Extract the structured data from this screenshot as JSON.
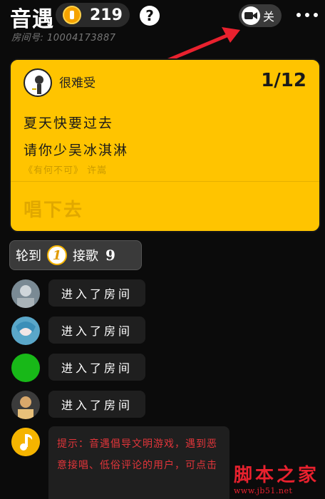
{
  "header": {
    "app_title": "音遇",
    "coin_count": "219",
    "help_label": "?",
    "room_number": "房间号: 10004173887",
    "camera_toggle_label": "关"
  },
  "song_card": {
    "singer_name": "很难受",
    "progress": "1/12",
    "lyrics": [
      "夏天快要过去",
      "请你少吴冰淇淋"
    ],
    "source": "《有何不可》 许嵩",
    "sing_on_label": "唱下去"
  },
  "turn_bar": {
    "prefix": "轮到",
    "turn_number": "1",
    "suffix": "接歌",
    "count": "9"
  },
  "messages": [
    {
      "text": "进入了房间",
      "avatar_color": "#7a8a94"
    },
    {
      "text": "进入了房间",
      "avatar_color": "#5aa7c9"
    },
    {
      "text": "进入了房间",
      "avatar_color": "#18b818"
    },
    {
      "text": "进入了房间",
      "avatar_color": "#3b3b3b"
    }
  ],
  "tip": {
    "text": "提示：音遇倡导文明游戏，遇到恶意接唱、低俗评论的用户，可点击"
  },
  "watermark": {
    "main": "脚本之家",
    "sub": "www.jb51.net"
  },
  "colors": {
    "card_yellow": "#ffc400",
    "tip_red": "#e2353a",
    "arrow_red": "#e8212e"
  },
  "icons": [
    "coin-icon",
    "help-icon",
    "video-camera-icon",
    "more-icon",
    "red-arrow-icon",
    "music-note-icon"
  ]
}
